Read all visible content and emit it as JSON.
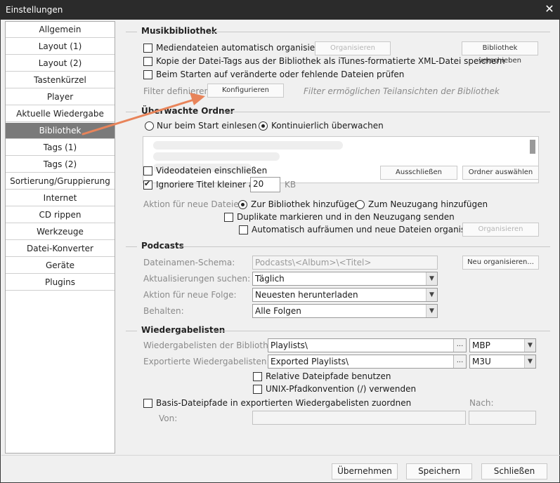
{
  "window": {
    "title": "Einstellungen"
  },
  "sidebar": {
    "items": [
      {
        "label": "Allgemein"
      },
      {
        "label": "Layout (1)"
      },
      {
        "label": "Layout (2)"
      },
      {
        "label": "Tastenkürzel"
      },
      {
        "label": "Player"
      },
      {
        "label": "Aktuelle Wiedergabe"
      },
      {
        "label": "Bibliothek"
      },
      {
        "label": "Tags (1)"
      },
      {
        "label": "Tags (2)"
      },
      {
        "label": "Sortierung/Gruppierung"
      },
      {
        "label": "Internet"
      },
      {
        "label": "CD rippen"
      },
      {
        "label": "Werkzeuge"
      },
      {
        "label": "Datei-Konverter"
      },
      {
        "label": "Geräte"
      },
      {
        "label": "Plugins"
      }
    ],
    "selected": "Bibliothek"
  },
  "musikbibliothek": {
    "title": "Musikbibliothek",
    "organize_label": "Mediendateien automatisch organisieren",
    "organize_button": "Organisieren",
    "move_button": "Bibliothek verschieben",
    "itunes_label": "Kopie der Datei-Tags aus der Bibliothek als iTunes-formatierte XML-Datei speichern",
    "check_label": "Beim Starten auf veränderte oder fehlende Dateien prüfen",
    "filter_label": "Filter definieren:",
    "filter_button": "Konfigurieren",
    "filter_hint": "Filter ermöglichen Teilansichten der Bibliothek"
  },
  "watched": {
    "title": "Überwachte Ordner",
    "radio_start": "Nur beim Start einlesen",
    "radio_continuous": "Kontinuierlich überwachen",
    "videos_label": "Videodateien einschließen",
    "exclude_button": "Ausschließen",
    "choose_button": "Ordner auswählen",
    "ignore_label": "Ignoriere Titel kleiner als",
    "ignore_value": "20",
    "ignore_unit": "KB",
    "action_label": "Aktion für neue Dateien:",
    "radio_library": "Zur Bibliothek hinzufügen",
    "radio_inbox": "Zum Neuzugang hinzufügen",
    "duplicates_label": "Duplikate markieren und in den Neuzugang senden",
    "cleanup_label": "Automatisch aufräumen und neue Dateien organisieren",
    "organize_button": "Organisieren"
  },
  "podcasts": {
    "title": "Podcasts",
    "schema_label": "Dateinamen-Schema:",
    "schema_value": "Podcasts\\<Album>\\<Titel>",
    "reorganize_button": "Neu organisieren...",
    "updates_label": "Aktualisierungen suchen:",
    "updates_value": "Täglich",
    "action_label": "Aktion für neue Folge:",
    "action_value": "Neuesten herunterladen",
    "keep_label": "Behalten:",
    "keep_value": "Alle Folgen"
  },
  "playlists": {
    "title": "Wiedergabelisten",
    "library_label": "Wiedergabelisten der Bibliothek:",
    "library_value": "Playlists\\",
    "library_format": "MBP",
    "export_label": "Exportierte Wiedergabelisten:",
    "export_value": "Exported Playlists\\",
    "export_format": "M3U",
    "relative_label": "Relative Dateipfade benutzen",
    "unix_label": "UNIX-Pfadkonvention (/) verwenden",
    "basis_label": "Basis-Dateipfade in exportierten Wiedergabelisten zuordnen",
    "from_label": "Von:",
    "to_label": "Nach:",
    "browse_label": "..."
  },
  "footer": {
    "apply": "Übernehmen",
    "save": "Speichern",
    "close": "Schließen"
  },
  "colors": {
    "titlebar": "#2b2b2b",
    "selected_item": "#7a7a7a",
    "arrow": "#e8845a"
  }
}
